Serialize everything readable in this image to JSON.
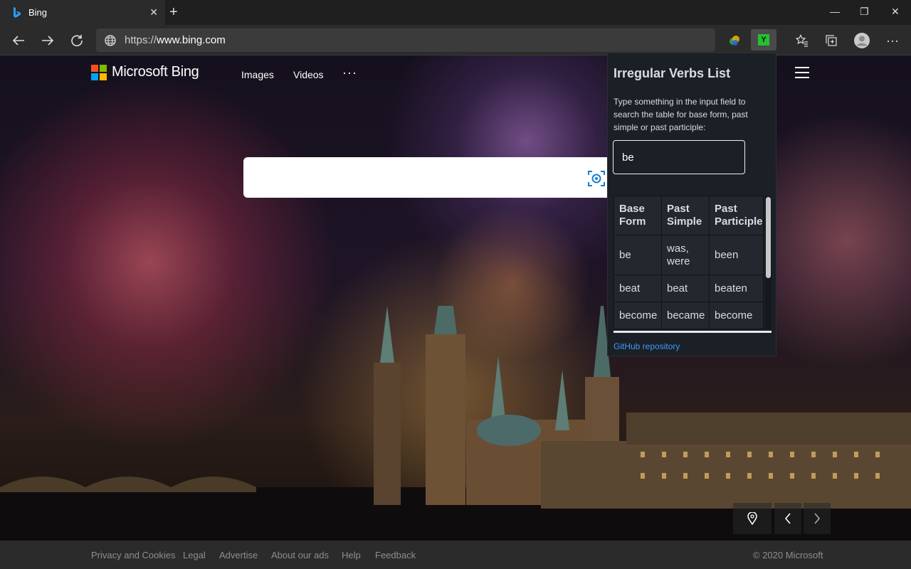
{
  "browser": {
    "tab_title": "Bing",
    "tab_close": "✕",
    "new_tab": "+",
    "url_prefix": "https://",
    "url_host": "www.bing.com",
    "window_controls": {
      "minimize": "—",
      "restore": "❐",
      "close": "✕"
    },
    "extension_label": "Y"
  },
  "bing": {
    "logo_text": "Microsoft Bing",
    "logo_colors": [
      "#f25022",
      "#7fba00",
      "#00a4ef",
      "#ffb900"
    ],
    "nav": [
      "Images",
      "Videos"
    ],
    "more": "···"
  },
  "popup": {
    "title": "Irregular Verbs List",
    "description": "Type something in the input field to search the table for base form, past simple or past participle:",
    "input_value": "be",
    "columns": [
      "Base Form",
      "Past Simple",
      "Past Participle"
    ],
    "rows": [
      [
        "be",
        "was, were",
        "been"
      ],
      [
        "beat",
        "beat",
        "beaten"
      ],
      [
        "become",
        "became",
        "become"
      ]
    ],
    "github_link": "GitHub repository"
  },
  "footer": {
    "links": [
      "Privacy and Cookies",
      "Legal",
      "Advertise",
      "About our ads",
      "Help",
      "Feedback"
    ],
    "copyright": "© 2020 Microsoft"
  }
}
